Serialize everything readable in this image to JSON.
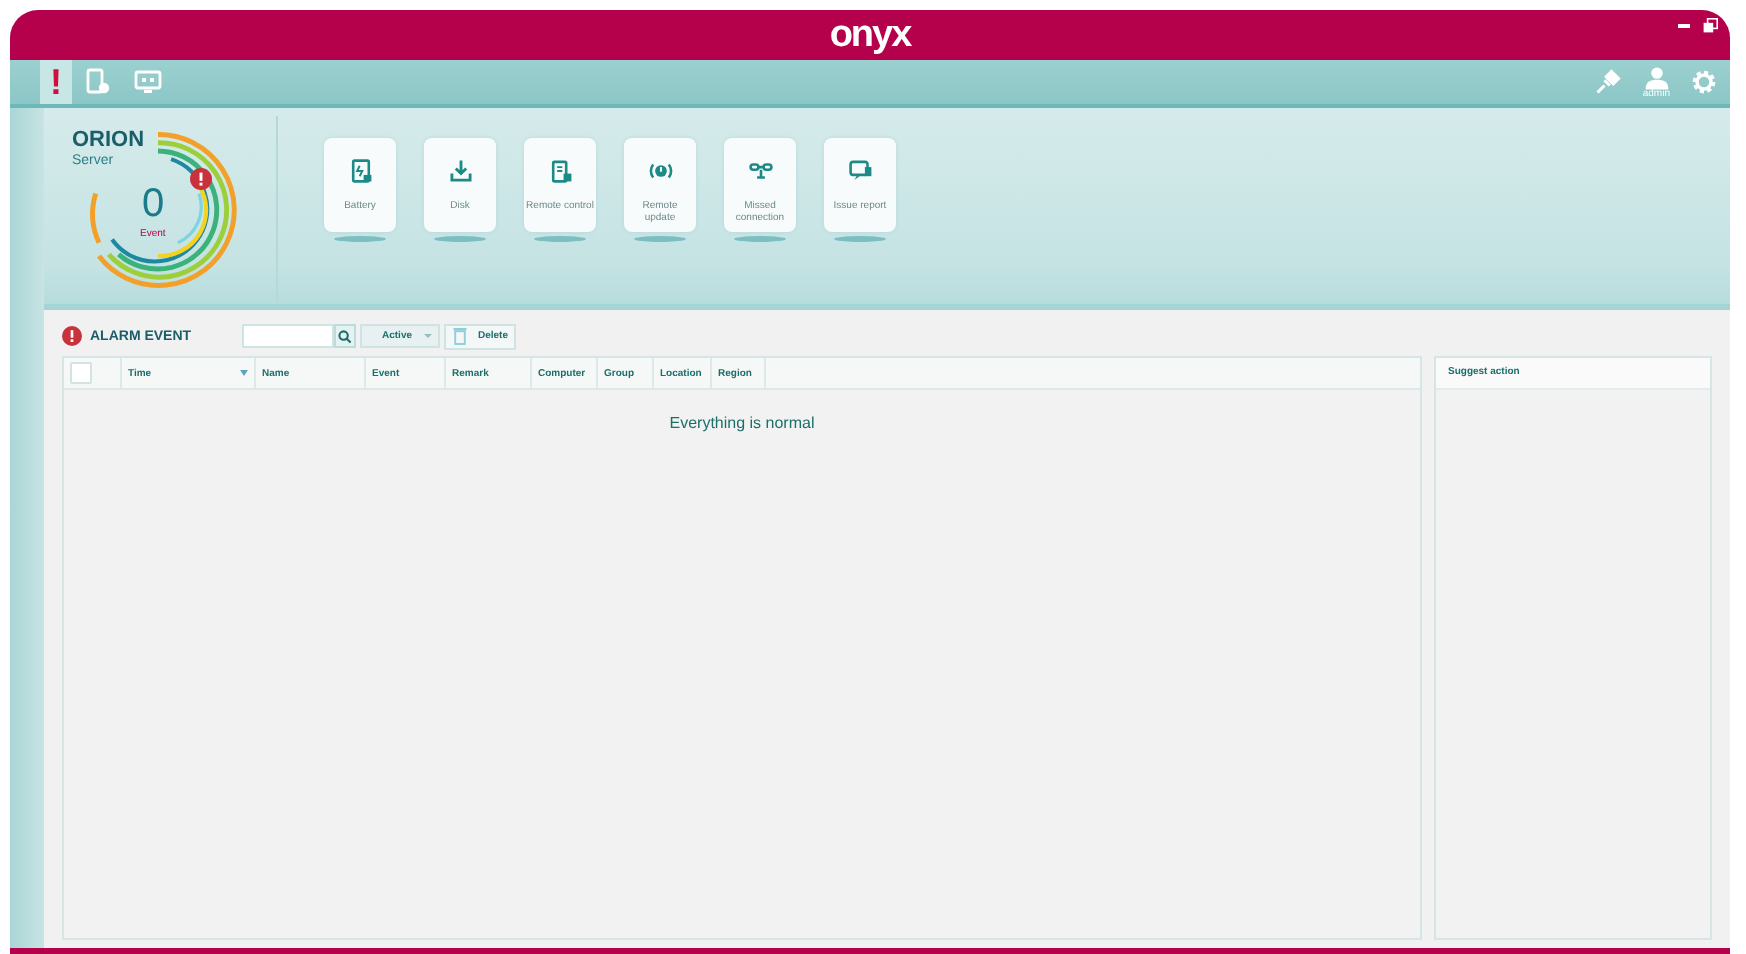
{
  "window": {
    "logo": "onyx"
  },
  "toolbar": {
    "tabs": [
      {
        "kind": "alert",
        "label": "!",
        "selected": true
      },
      {
        "kind": "device",
        "selected": false
      },
      {
        "kind": "screen",
        "selected": false
      }
    ],
    "user": "admin"
  },
  "server": {
    "name": "ORION",
    "type": "Server",
    "count": "0",
    "count_label": "Event"
  },
  "tiles": [
    {
      "kind": "battery",
      "label": "Battery"
    },
    {
      "kind": "disk",
      "label": "Disk"
    },
    {
      "kind": "remote",
      "label": "Remote control"
    },
    {
      "kind": "update",
      "label": "Remote update"
    },
    {
      "kind": "link",
      "label": "Missed connection"
    },
    {
      "kind": "chat",
      "label": "Issue report"
    }
  ],
  "alarm": {
    "title": "ALARM EVENT",
    "filter": "Active",
    "delete": "Delete"
  },
  "table": {
    "columns": [
      {
        "label": "Time",
        "sorted": true
      },
      {
        "label": "Name",
        "sorted": false
      },
      {
        "label": "Event",
        "sorted": false
      },
      {
        "label": "Remark",
        "sorted": false
      },
      {
        "label": "Computer",
        "sorted": false
      },
      {
        "label": "Group",
        "sorted": false
      },
      {
        "label": "Location",
        "sorted": false
      },
      {
        "label": "Region",
        "sorted": false
      }
    ],
    "select_all": false,
    "empty_message": "Everything is normal"
  },
  "side_panel": {
    "title": "Suggest action"
  }
}
